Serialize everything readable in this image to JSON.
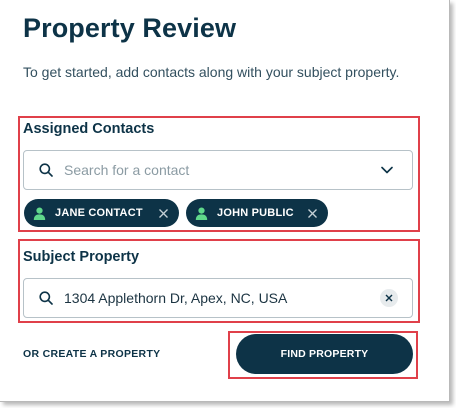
{
  "page": {
    "title": "Property Review",
    "intro": "To get started, add contacts along with your subject property."
  },
  "contacts": {
    "label": "Assigned Contacts",
    "search_placeholder": "Search for a contact",
    "chips": [
      {
        "name": "JANE CONTACT",
        "icon": "person-icon"
      },
      {
        "name": "JOHN PUBLIC",
        "icon": "person-icon"
      }
    ]
  },
  "property": {
    "label": "Subject Property",
    "value": "1304 Applethorn Dr, Apex, NC, USA"
  },
  "actions": {
    "create_link": "OR CREATE A PROPERTY",
    "find_button": "FIND PROPERTY"
  },
  "colors": {
    "primary": "#0d3347",
    "chip_icon": "#5fd88b",
    "highlight": "#e0404a"
  }
}
